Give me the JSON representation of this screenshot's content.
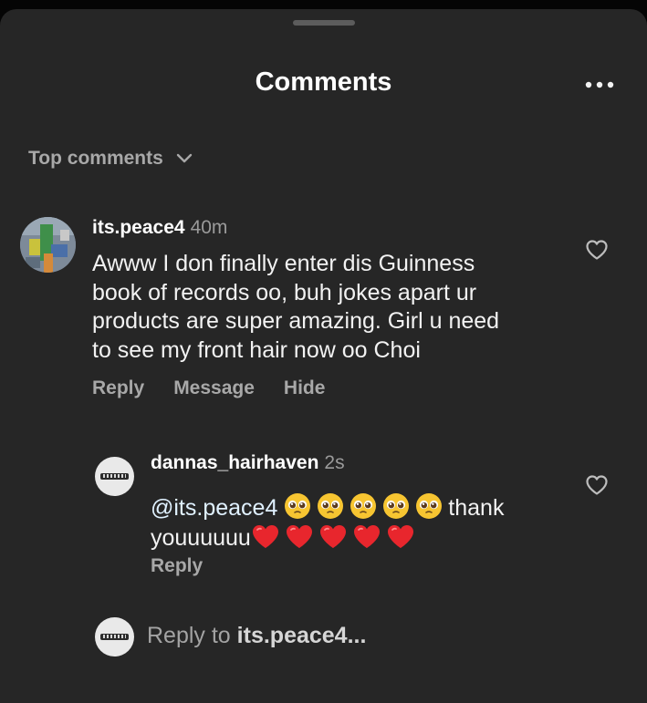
{
  "sheet": {
    "title": "Comments",
    "more_icon": "more-horizontal-icon"
  },
  "sort": {
    "label": "Top comments",
    "icon": "chevron-down-icon"
  },
  "comment": {
    "username": "its.peace4",
    "time": "40m",
    "lines": [
      "Awww I don finally enter dis Guinness",
      "book of records oo, buh jokes apart ur",
      "products are super amazing. Girl u need",
      "to see my front hair now oo Choi"
    ],
    "actions": [
      "Reply",
      "Message",
      "Hide"
    ],
    "like_icon": "heart-outline-icon"
  },
  "reply": {
    "username": "dannas_hairhaven",
    "time": "2s",
    "mention": "@its.peace4",
    "word1": "thank",
    "word2": "youuuuuu",
    "pleading_emoji_count": 5,
    "heart_emoji_count": 5,
    "action": "Reply",
    "like_icon": "heart-outline-icon"
  },
  "composer": {
    "prefix": "Reply to ",
    "target": "its.peace4...",
    "avatar_icon": "profile-avatar-icon"
  },
  "colors": {
    "sheet_bg": "#262626",
    "text": "#f2f2f2",
    "muted": "#a8a8a8",
    "heart": "#e8262d",
    "emoji_face": "#f7c531"
  }
}
